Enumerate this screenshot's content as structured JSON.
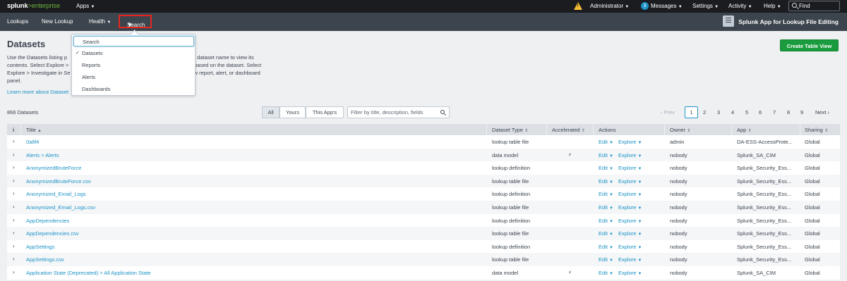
{
  "topbar": {
    "brand_main": "splunk",
    "brand_gt": ">",
    "brand_sub": "enterprise",
    "apps": "Apps",
    "user": "Administrator",
    "messages_count": "3",
    "messages": "Messages",
    "settings": "Settings",
    "activity": "Activity",
    "help": "Help",
    "find_placeholder": "Find"
  },
  "appbar": {
    "items": [
      "Lookups",
      "New Lookup",
      "Health"
    ],
    "search": "Search",
    "app_title": "Splunk App for Lookup File Editing"
  },
  "dropdown": {
    "items": [
      "Search",
      "Datasets",
      "Reports",
      "Alerts",
      "Dashboards"
    ],
    "checked": "Datasets"
  },
  "page": {
    "title": "Datasets",
    "desc_lines": [
      "Use the Datasets listing p",
      "contents. Select Explore >",
      "Explore > Investigate in Se",
      "panel."
    ],
    "desc_right": [
      "lick a dataset name to view its",
      "port based on the dataset. Select",
      "a new report, alert, or dashboard"
    ],
    "learn_more": "Learn more about Dataset",
    "create_button": "Create Table View"
  },
  "toolbar": {
    "count": "866 Datasets",
    "filters": [
      "All",
      "Yours",
      "This App's"
    ],
    "filter_placeholder": "Filter by title, description, fields",
    "prev": "‹ Prev",
    "pages": [
      "1",
      "2",
      "3",
      "4",
      "5",
      "6",
      "7",
      "8",
      "9"
    ],
    "current_page": "1",
    "next": "Next ›"
  },
  "table": {
    "columns": [
      "i",
      "Title",
      "Dataset Type",
      "Accelerated",
      "Actions",
      "Owner",
      "App",
      "Sharing"
    ],
    "edit_label": "Edit",
    "explore_label": "Explore",
    "rows": [
      {
        "title": "0altf4",
        "type": "lookup table file",
        "accel": "",
        "owner": "admin",
        "app": "DA-ESS-AccessProte...",
        "sharing": "Global"
      },
      {
        "title": "Alerts > Alerts",
        "type": "data model",
        "accel": "⚡",
        "owner": "nobody",
        "app": "Splunk_SA_CIM",
        "sharing": "Global"
      },
      {
        "title": "AnonymizedBruteForce",
        "type": "lookup definition",
        "accel": "",
        "owner": "nobody",
        "app": "Splunk_Security_Ess...",
        "sharing": "Global"
      },
      {
        "title": "AnonymizedBruteForce.csv",
        "type": "lookup table file",
        "accel": "",
        "owner": "nobody",
        "app": "Splunk_Security_Ess...",
        "sharing": "Global"
      },
      {
        "title": "Anonymized_Email_Logs",
        "type": "lookup definition",
        "accel": "",
        "owner": "nobody",
        "app": "Splunk_Security_Ess...",
        "sharing": "Global"
      },
      {
        "title": "Anonymized_Email_Logs.csv",
        "type": "lookup table file",
        "accel": "",
        "owner": "nobody",
        "app": "Splunk_Security_Ess...",
        "sharing": "Global"
      },
      {
        "title": "AppDependencies",
        "type": "lookup definition",
        "accel": "",
        "owner": "nobody",
        "app": "Splunk_Security_Ess...",
        "sharing": "Global"
      },
      {
        "title": "AppDependencies.csv",
        "type": "lookup table file",
        "accel": "",
        "owner": "nobody",
        "app": "Splunk_Security_Ess...",
        "sharing": "Global"
      },
      {
        "title": "AppSettings",
        "type": "lookup definition",
        "accel": "",
        "owner": "nobody",
        "app": "Splunk_Security_Ess...",
        "sharing": "Global"
      },
      {
        "title": "AppSettings.csv",
        "type": "lookup table file",
        "accel": "",
        "owner": "nobody",
        "app": "Splunk_Security_Ess...",
        "sharing": "Global"
      },
      {
        "title": "Application State (Deprecated) > All Application State",
        "type": "data model",
        "accel": "⚡",
        "owner": "nobody",
        "app": "Splunk_SA_CIM",
        "sharing": "Global"
      }
    ]
  },
  "colors": {
    "topbar": "#1a1c20",
    "appbar": "#3c444d",
    "link": "#1e93c6",
    "create_button": "#1a9c3e",
    "highlight_border": "#e5261f"
  }
}
